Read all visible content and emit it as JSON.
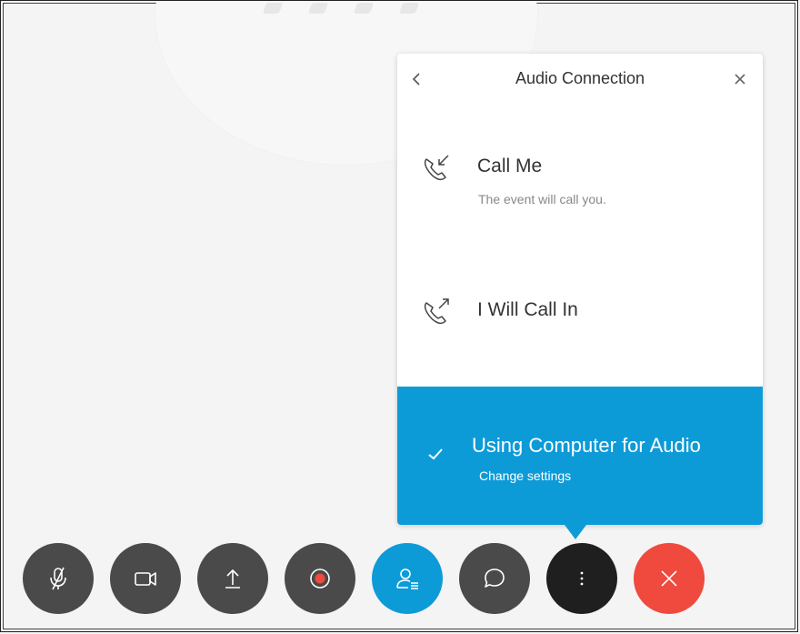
{
  "popover": {
    "title": "Audio Connection",
    "back_icon": "chevron-left-icon",
    "close_icon": "close-icon",
    "options": {
      "call_me": {
        "label": "Call Me",
        "subtitle": "The event will call you.",
        "icon": "phone-incoming-icon"
      },
      "call_in": {
        "label": "I Will Call In",
        "icon": "phone-outgoing-icon"
      }
    },
    "selected": {
      "label": "Using Computer for Audio",
      "link": "Change settings",
      "icon": "checkmark-icon",
      "color": "#0d9bd8"
    }
  },
  "toolbar": {
    "buttons": [
      {
        "name": "mute",
        "icon": "microphone-muted-icon",
        "color": "#4a4a4a"
      },
      {
        "name": "video",
        "icon": "video-camera-icon",
        "color": "#4a4a4a"
      },
      {
        "name": "share",
        "icon": "upload-icon",
        "color": "#4a4a4a"
      },
      {
        "name": "record",
        "icon": "record-icon",
        "color": "#4a4a4a"
      },
      {
        "name": "participants",
        "icon": "participants-icon",
        "color": "#0d9bd8"
      },
      {
        "name": "chat",
        "icon": "chat-bubble-icon",
        "color": "#4a4a4a"
      },
      {
        "name": "more",
        "icon": "more-vertical-icon",
        "color": "#1f1f1f"
      },
      {
        "name": "leave",
        "icon": "close-icon",
        "color": "#f0493e"
      }
    ]
  }
}
